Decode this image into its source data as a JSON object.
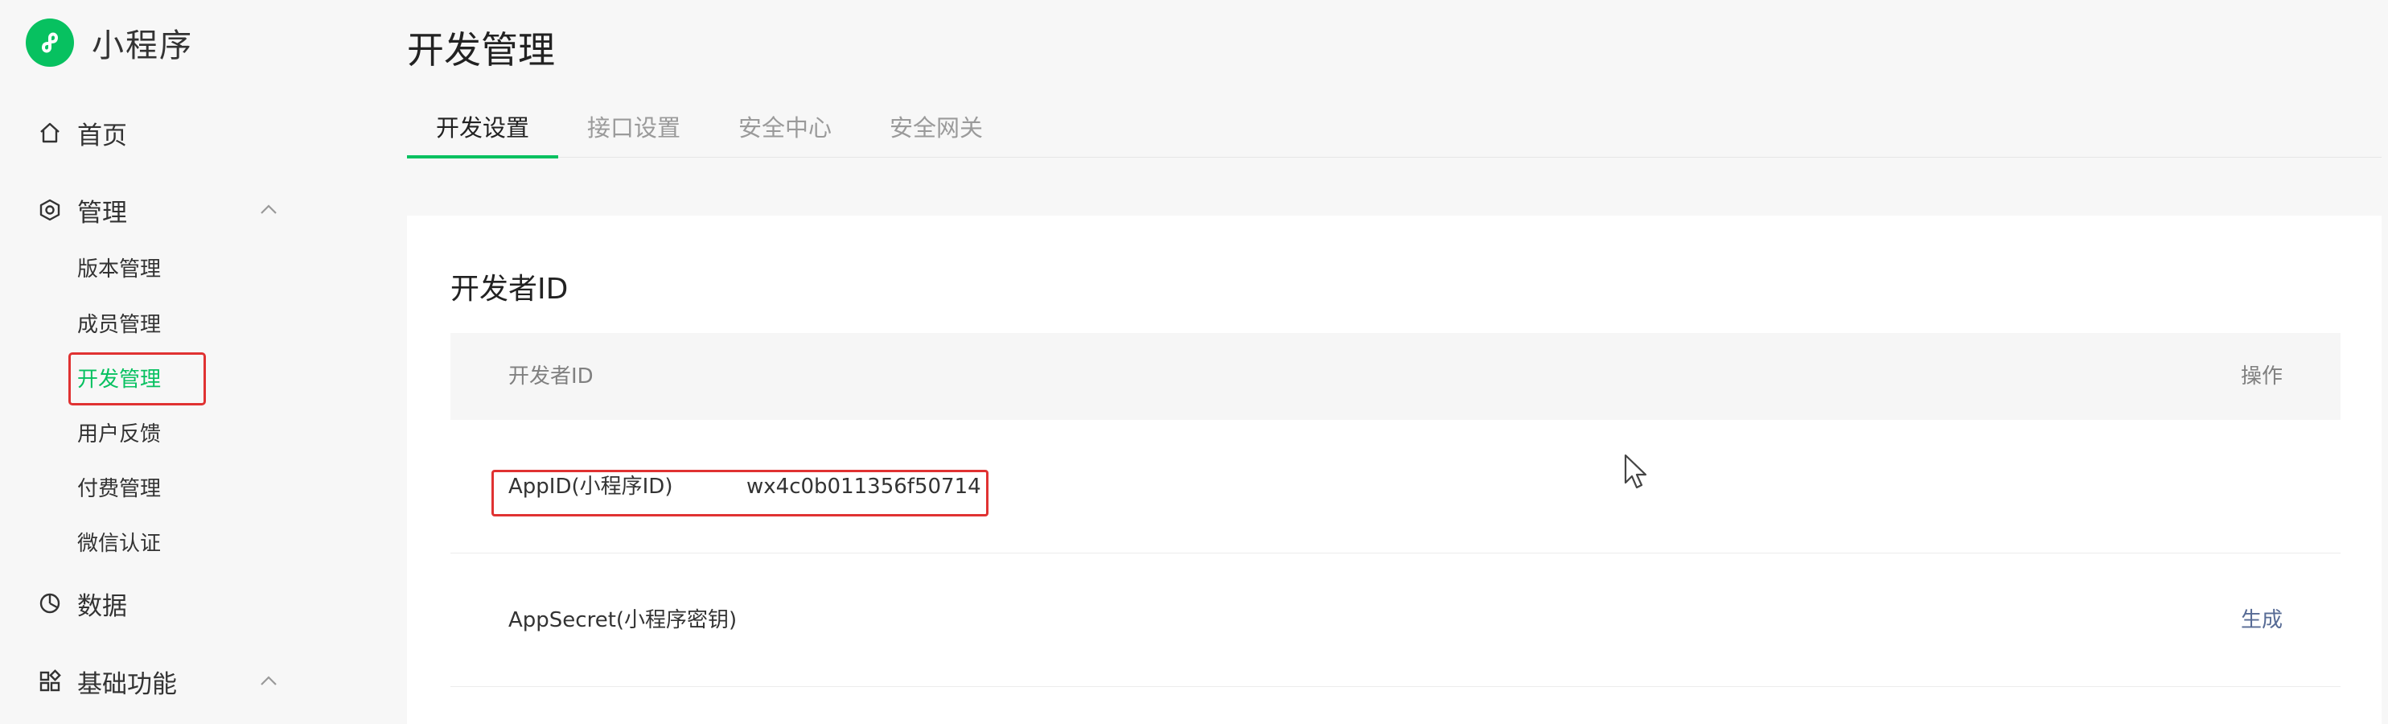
{
  "brand": {
    "name": "小程序",
    "logo_icon": "miniprogram-logo-icon",
    "accent": "#07c160"
  },
  "sidebar": {
    "items": [
      {
        "label": "首页",
        "icon": "home-icon"
      },
      {
        "label": "管理",
        "icon": "hexagon-settings-icon",
        "expanded": true,
        "children": [
          {
            "label": "版本管理"
          },
          {
            "label": "成员管理"
          },
          {
            "label": "开发管理",
            "active": true
          },
          {
            "label": "用户反馈"
          },
          {
            "label": "付费管理"
          },
          {
            "label": "微信认证"
          }
        ]
      },
      {
        "label": "数据",
        "icon": "pie-chart-icon"
      },
      {
        "label": "基础功能",
        "icon": "grid-apps-icon",
        "expanded": true
      }
    ]
  },
  "header": {
    "title": "开发管理",
    "tabs": [
      {
        "label": "开发设置",
        "active": true
      },
      {
        "label": "接口设置"
      },
      {
        "label": "安全中心"
      },
      {
        "label": "安全网关"
      }
    ]
  },
  "main": {
    "section_title": "开发者ID",
    "table": {
      "headers": {
        "left": "开发者ID",
        "right": "操作"
      },
      "rows": [
        {
          "label": "AppID(小程序ID)",
          "value": "wx4c0b011356f50714",
          "action": ""
        },
        {
          "label": "AppSecret(小程序密钥)",
          "value": "",
          "action": "生成"
        }
      ]
    }
  },
  "colors": {
    "highlight": "#e03232",
    "link": "#576b95",
    "active_green": "#07c160"
  }
}
